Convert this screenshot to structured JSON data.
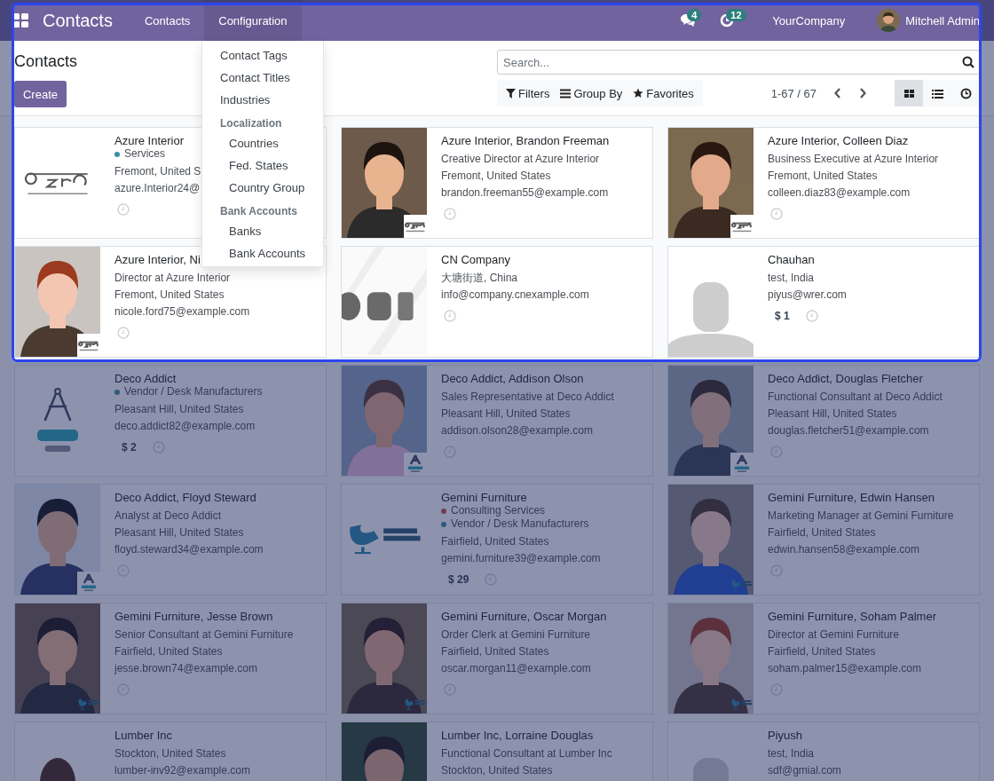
{
  "navbar": {
    "title": "Contacts",
    "menus": [
      {
        "label": "Contacts",
        "selected": false
      },
      {
        "label": "Configuration",
        "selected": true
      }
    ],
    "messages_badge": "4",
    "activities_badge": "12",
    "company": "YourCompany",
    "user": "Mitchell Admin"
  },
  "config_menu": [
    {
      "label": "Contact Tags"
    },
    {
      "label": "Contact Titles"
    },
    {
      "label": "Industries"
    },
    {
      "label": "Localization",
      "children": [
        {
          "label": "Countries"
        },
        {
          "label": "Fed. States"
        },
        {
          "label": "Country Group"
        }
      ]
    },
    {
      "label": "Bank Accounts",
      "children": [
        {
          "label": "Banks"
        },
        {
          "label": "Bank Accounts"
        }
      ]
    }
  ],
  "control_panel": {
    "title": "Contacts",
    "create": "Create",
    "search": {
      "placeholder": "Search..."
    },
    "filters": "Filters",
    "group_by": "Group By",
    "favorites": "Favorites",
    "pager": "1-67 / 67",
    "views": [
      {
        "kind": "kanban",
        "selected": true
      },
      {
        "kind": "list",
        "selected": false
      },
      {
        "kind": "activity",
        "selected": false
      }
    ]
  },
  "cards": [
    {
      "name": "Azure Interior",
      "tags": [
        {
          "label": "Services",
          "color": "#3a8fa0"
        }
      ],
      "lines": [
        "Fremont, United S",
        "azure.Interior24@"
      ],
      "image": {
        "kind": "logo"
      }
    },
    {
      "name": "Azure Interior, Brandon Freeman",
      "lines": [
        "Creative Director at Azure Interior",
        "Fremont, United States",
        "brandon.freeman55@example.com"
      ],
      "image": {
        "kind": "picture"
      }
    },
    {
      "name": "Azure Interior, Colleen Diaz",
      "lines": [
        "Business Executive at Azure Interior",
        "Fremont, United States",
        "colleen.diaz83@example.com"
      ],
      "image": {
        "kind": "picture"
      }
    },
    {
      "name": "Azure Interior, Ni",
      "lines": [
        "Director at Azure Interior",
        "Fremont, United States",
        "nicole.ford75@example.com"
      ],
      "image": {
        "kind": "picture"
      }
    },
    {
      "name": "CN Company",
      "lines": [
        "大塘街道, China",
        "info@company.cnexample.com"
      ],
      "image": {
        "kind": "logo"
      }
    },
    {
      "name": "Chauhan",
      "lines": [
        "test, India",
        "piyus@wrer.com"
      ],
      "amount": "$ 1",
      "image": {
        "kind": "placeholder"
      }
    },
    {
      "name": "Deco Addict",
      "tags": [
        {
          "label": "Vendor / Desk Manufacturers",
          "color": "#2c5b7e"
        }
      ],
      "lines": [
        "Pleasant Hill, United States",
        "deco.addict82@example.com"
      ],
      "amount": "$ 2",
      "image": {
        "kind": "logo"
      }
    },
    {
      "name": "Deco Addict, Addison Olson",
      "lines": [
        "Sales Representative at Deco Addict",
        "Pleasant Hill, United States",
        "addison.olson28@example.com"
      ],
      "image": {
        "kind": "picture"
      }
    },
    {
      "name": "Deco Addict, Douglas Fletcher",
      "lines": [
        "Functional Consultant at Deco Addict",
        "Pleasant Hill, United States",
        "douglas.fletcher51@example.com"
      ],
      "image": {
        "kind": "picture"
      }
    },
    {
      "name": "Deco Addict, Floyd Steward",
      "lines": [
        "Analyst at Deco Addict",
        "Pleasant Hill, United States",
        "floyd.steward34@example.com"
      ],
      "image": {
        "kind": "picture"
      }
    },
    {
      "name": "Gemini Furniture",
      "tags": [
        {
          "label": "Consulting Services",
          "color": "#743c53"
        },
        {
          "label": "Vendor / Desk Manufacturers",
          "color": "#2c5b7e"
        }
      ],
      "lines": [
        "Fairfield, United States",
        "gemini.furniture39@example.com"
      ],
      "amount": "$ 29",
      "image": {
        "kind": "logo"
      }
    },
    {
      "name": "Gemini Furniture, Edwin Hansen",
      "lines": [
        "Marketing Manager at Gemini Furniture",
        "Fairfield, United States",
        "edwin.hansen58@example.com"
      ],
      "image": {
        "kind": "picture"
      }
    },
    {
      "name": "Gemini Furniture, Jesse Brown",
      "lines": [
        "Senior Consultant at Gemini Furniture",
        "Fairfield, United States",
        "jesse.brown74@example.com"
      ],
      "image": {
        "kind": "picture"
      }
    },
    {
      "name": "Gemini Furniture, Oscar Morgan",
      "lines": [
        "Order Clerk at Gemini Furniture",
        "Fairfield, United States",
        "oscar.morgan11@example.com"
      ],
      "image": {
        "kind": "picture"
      }
    },
    {
      "name": "Gemini Furniture, Soham Palmer",
      "lines": [
        "Director at Gemini Furniture",
        "Fairfield, United States",
        "soham.palmer15@example.com"
      ],
      "image": {
        "kind": "picture"
      }
    },
    {
      "name": "Lumber Inc",
      "lines": [
        "Stockton, United States",
        "lumber-inv92@example.com"
      ],
      "image": {
        "kind": "logo"
      }
    },
    {
      "name": "Lumber Inc, Lorraine Douglas",
      "lines": [
        "Functional Consultant at Lumber Inc",
        "Stockton, United States"
      ],
      "image": {
        "kind": "picture"
      }
    },
    {
      "name": "Piyush",
      "lines": [
        "test, India",
        "sdf@gmial.com"
      ],
      "image": {
        "kind": "placeholder"
      }
    }
  ]
}
